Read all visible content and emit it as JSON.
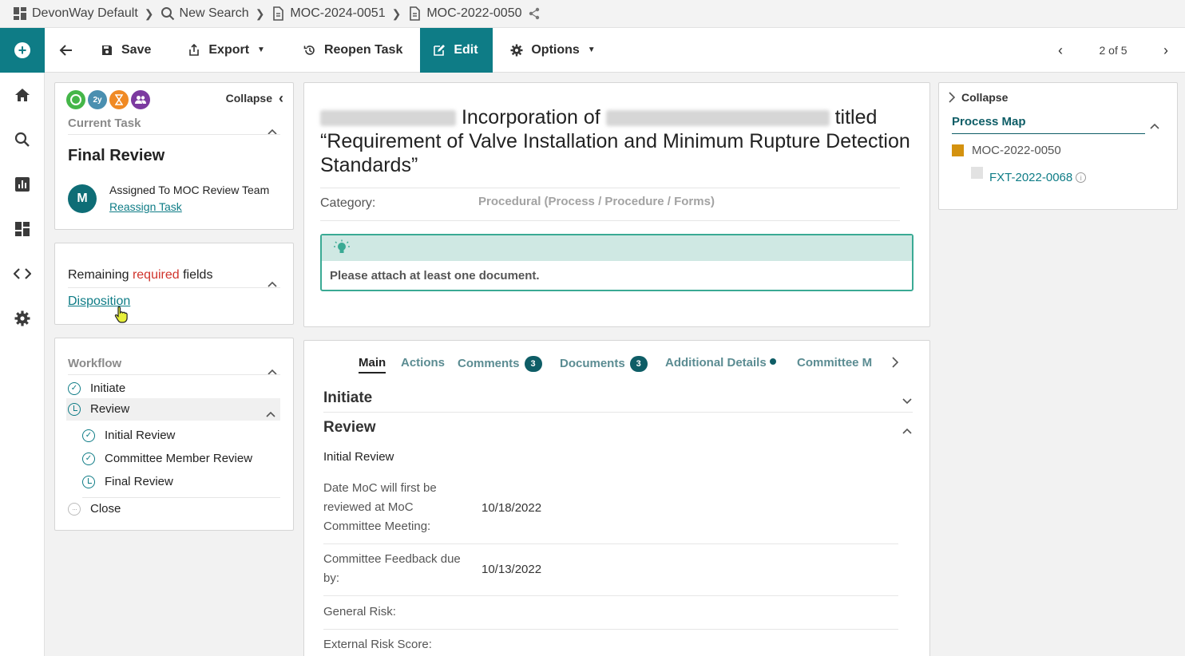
{
  "breadcrumb": {
    "items": [
      "DevonWay Default",
      "New Search",
      "MOC-2024-0051",
      "MOC-2022-0050"
    ]
  },
  "toolbar": {
    "save": "Save",
    "export": "Export",
    "reopen": "Reopen Task",
    "edit": "Edit",
    "options": "Options",
    "pager": "2 of 5"
  },
  "task_panel": {
    "collapse": "Collapse",
    "heading": "Current Task",
    "task_name": "Final Review",
    "avatar_letter": "M",
    "assigned": "Assigned To MOC Review Team",
    "reassign": "Reassign Task",
    "status_icons": [
      "check-clock-icon",
      "2y-icon",
      "hourglass-icon",
      "group-icon"
    ],
    "status_icon_label": "2y"
  },
  "required_panel": {
    "prefix": "Remaining",
    "required": "required",
    "suffix": "fields",
    "link": "Disposition"
  },
  "workflow": {
    "heading": "Workflow",
    "steps": [
      {
        "label": "Initiate",
        "status": "done"
      },
      {
        "label": "Review",
        "status": "in-progress"
      },
      {
        "label": "Initial Review",
        "status": "done"
      },
      {
        "label": "Committee Member Review",
        "status": "done"
      },
      {
        "label": "Final Review",
        "status": "in-progress"
      },
      {
        "label": "Close",
        "status": "pending"
      }
    ]
  },
  "record": {
    "title_part1": "Incorporation of",
    "title_part2": "titled",
    "title_part3": "“Requirement of Valve Installation and Minimum Rupture Detection Standards”",
    "category_label": "Category:",
    "category_value": "Procedural (Process / Procedure / Forms)",
    "alert": "Please attach at least one document."
  },
  "tabs": {
    "main": "Main",
    "actions": "Actions",
    "comments": "Comments",
    "comments_count": "3",
    "documents": "Documents",
    "documents_count": "3",
    "additional": "Additional Details",
    "committee": "Committee M"
  },
  "main_content": {
    "initiate": "Initiate",
    "review": "Review",
    "subsection": "Initial Review",
    "fields": [
      {
        "label": "Date MoC will first be reviewed at MoC Committee Meeting:",
        "value": "10/18/2022"
      },
      {
        "label": "Committee Feedback due by:",
        "value": "10/13/2022"
      },
      {
        "label": "General Risk:",
        "value": ""
      },
      {
        "label": "External Risk Score:",
        "value": ""
      }
    ]
  },
  "process_map": {
    "collapse": "Collapse",
    "heading": "Process Map",
    "parent": "MOC-2022-0050",
    "child": "FXT-2022-0068"
  },
  "colors": {
    "teal": "#0e7c86",
    "required_red": "#d0342c",
    "parent_marker": "#d4920f",
    "alert_bg": "#cfe8e3"
  }
}
